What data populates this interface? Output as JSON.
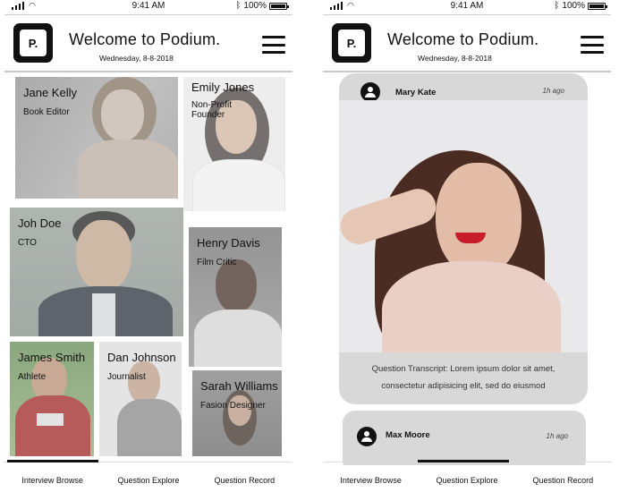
{
  "status": {
    "time": "9:41 AM",
    "battery": "100%",
    "battery_level": 1.0
  },
  "header": {
    "logo": "P.",
    "title": "Welcome to Podium.",
    "date": "Wednesday, 8-8-2018"
  },
  "browse": {
    "profiles": [
      {
        "name": "Jane Kelly",
        "role": "Book Editor"
      },
      {
        "name": "Emily Jones",
        "role": "Non-Profit Founder"
      },
      {
        "name": "Joh Doe",
        "role": "CTO"
      },
      {
        "name": "Henry Davis",
        "role": "Film Critic"
      },
      {
        "name": "James Smith",
        "role": "Athlete"
      },
      {
        "name": "Dan Johnson",
        "role": "Journalist"
      },
      {
        "name": "Sarah Williams",
        "role": "Fasion Designer"
      }
    ]
  },
  "feed": {
    "posts": [
      {
        "user": "Mary Kate",
        "time": "1h ago",
        "transcript": "Question Transcript: Lorem ipsum dolor sit amet, consectetur adipisicing elit, sed do eiusmod"
      },
      {
        "user": "Max Moore",
        "time": "1h ago"
      }
    ]
  },
  "tabs": [
    "Interview Browse",
    "Question Explore",
    "Question Record"
  ],
  "icons": [
    "signal-icon",
    "wifi-icon",
    "bluetooth-icon",
    "battery-icon",
    "menu-icon",
    "user-icon"
  ],
  "colors": {
    "accent": "#111111",
    "card": "#d8d8d8",
    "overlay": "#c8c8c8"
  }
}
